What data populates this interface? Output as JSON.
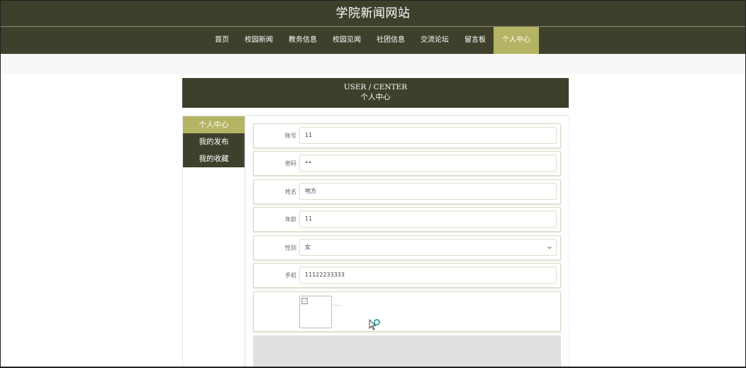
{
  "site": {
    "title": "学院新闻网站"
  },
  "nav": {
    "items": [
      {
        "label": "首页",
        "active": false
      },
      {
        "label": "校园新闻",
        "active": false
      },
      {
        "label": "教务信息",
        "active": false
      },
      {
        "label": "校园见闻",
        "active": false
      },
      {
        "label": "社团信息",
        "active": false
      },
      {
        "label": "交流论坛",
        "active": false
      },
      {
        "label": "留言板",
        "active": false
      },
      {
        "label": "个人中心",
        "active": true
      }
    ]
  },
  "page": {
    "title_en": "USER / CENTER",
    "title_cn": "个人中心"
  },
  "sidebar": {
    "items": [
      {
        "label": "个人中心",
        "active": true
      },
      {
        "label": "我的发布",
        "active": false
      },
      {
        "label": "我的收藏",
        "active": false
      }
    ]
  },
  "form": {
    "account": {
      "label": "账号",
      "value": "11"
    },
    "password": {
      "label": "密码",
      "value": "••"
    },
    "name": {
      "label": "姓名",
      "value": "地方"
    },
    "age": {
      "label": "年龄",
      "value": "11"
    },
    "gender": {
      "label": "性别",
      "value": "女"
    },
    "phone": {
      "label": "手机",
      "value": "11122233333"
    }
  },
  "colors": {
    "header_bg": "#3f402c",
    "accent": "#b4b464"
  },
  "icons": {
    "select_arrow": "chevron-down-icon",
    "avatar": "broken-image-icon",
    "cursor": "mouse-pointer-icon"
  }
}
